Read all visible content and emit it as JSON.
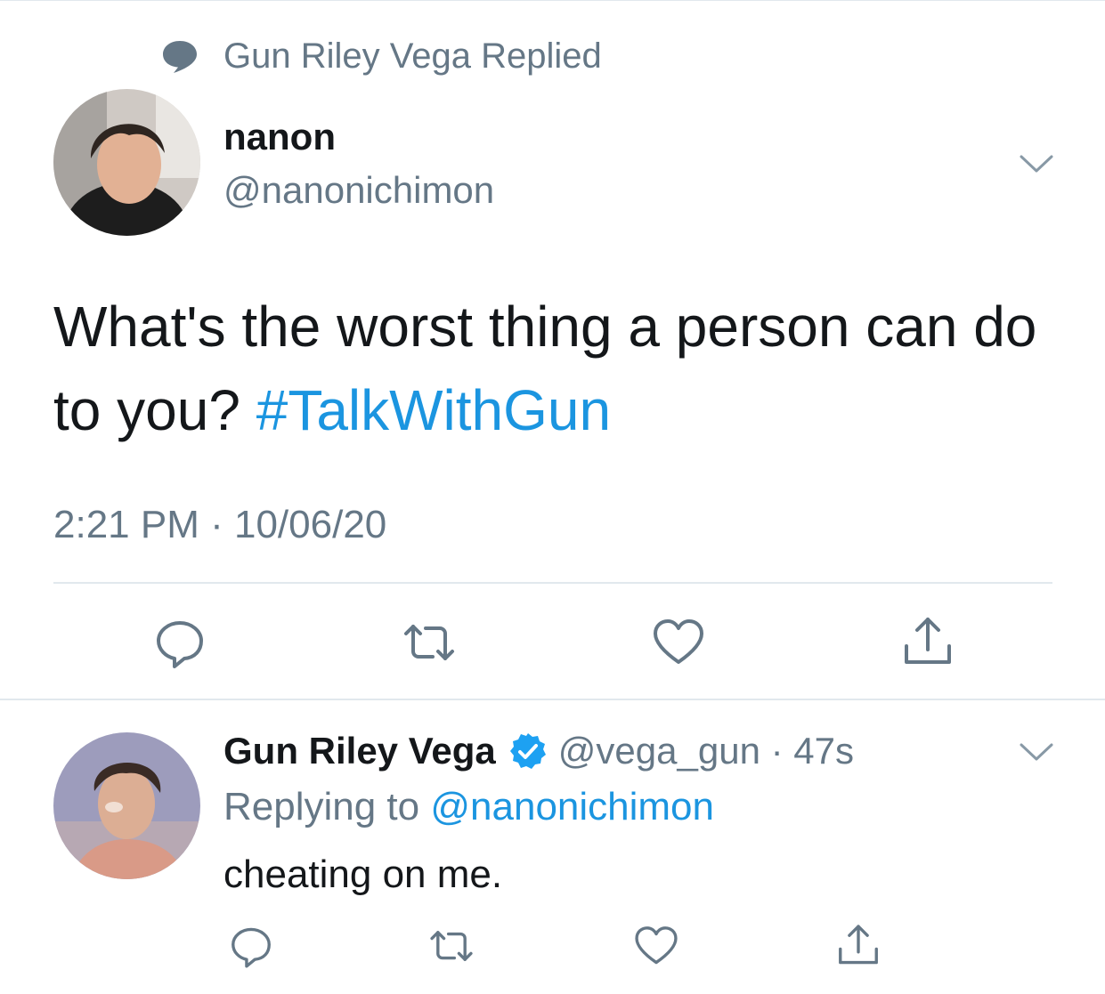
{
  "context": {
    "icon": "speech-bubble-icon",
    "text": "Gun Riley Vega Replied"
  },
  "main_tweet": {
    "name": "nanon",
    "handle": "@nanonichimon",
    "text": "What's the worst thing a person can do to you? ",
    "hashtag": "#TalkWithGun",
    "timestamp": "2:21 PM",
    "date_sep": " · ",
    "date": "10/06/20"
  },
  "reply": {
    "name": "Gun Riley Vega",
    "handle": "@vega_gun",
    "time_sep": " · ",
    "time": "47s",
    "replying_prefix": "Replying to ",
    "replying_to": "@nanonichimon",
    "text": "cheating on me."
  },
  "actions": [
    "reply-icon",
    "retweet-icon",
    "like-icon",
    "share-icon"
  ],
  "colors": {
    "accent": "#1b95e0",
    "muted": "#657786",
    "text": "#14171a",
    "divider": "#e1e8ed"
  }
}
